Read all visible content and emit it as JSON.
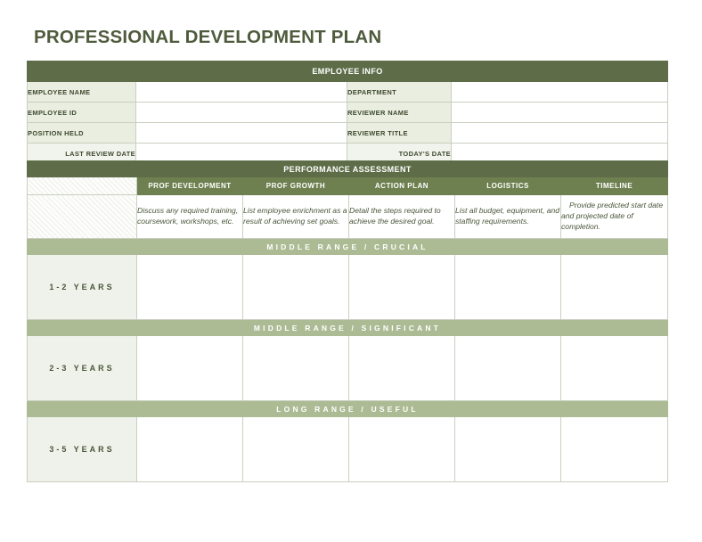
{
  "document": {
    "title": "PROFESSIONAL DEVELOPMENT PLAN"
  },
  "employee_info": {
    "section_title": "EMPLOYEE INFO",
    "rows": [
      {
        "left_label": "EMPLOYEE NAME",
        "left_value": "",
        "right_label": "DEPARTMENT",
        "right_value": ""
      },
      {
        "left_label": "EMPLOYEE ID",
        "left_value": "",
        "right_label": "REVIEWER NAME",
        "right_value": ""
      },
      {
        "left_label": "POSITION HELD",
        "left_value": "",
        "right_label": "REVIEWER TITLE",
        "right_value": ""
      }
    ],
    "date_row": {
      "last_review_label": "LAST REVIEW DATE",
      "last_review_value": "",
      "todays_date_label": "TODAY'S DATE",
      "todays_date_value": ""
    }
  },
  "assessment": {
    "section_title": "PERFORMANCE ASSESSMENT",
    "columns": [
      "PROF DEVELOPMENT",
      "PROF GROWTH",
      "ACTION PLAN",
      "LOGISTICS",
      "TIMELINE"
    ],
    "descriptions": [
      "Discuss any required training, coursework, workshops, etc.",
      "List employee enrichment as a result of achieving set goals.",
      "Detail the steps required to achieve the desired goal.",
      "List all budget, equipment, and staffing requirements.",
      "Provide predicted start date and projected date of completion."
    ],
    "bands": [
      {
        "band_label": "MIDDLE RANGE  /  CRUCIAL",
        "year_label": "1-2 YEARS",
        "cells": [
          "",
          "",
          "",
          "",
          ""
        ]
      },
      {
        "band_label": "MIDDLE RANGE  /  SIGNIFICANT",
        "year_label": "2-3 YEARS",
        "cells": [
          "",
          "",
          "",
          "",
          ""
        ]
      },
      {
        "band_label": "LONG RANGE  /  USEFUL",
        "year_label": "3-5 YEARS",
        "cells": [
          "",
          "",
          "",
          "",
          ""
        ]
      }
    ]
  },
  "colors": {
    "header_dark": "#5e6d48",
    "column_header": "#6e8050",
    "band_green": "#acbb94",
    "label_bg": "#e9eee0",
    "year_bg": "#eef2ea",
    "title_text": "#4e5b3c"
  }
}
